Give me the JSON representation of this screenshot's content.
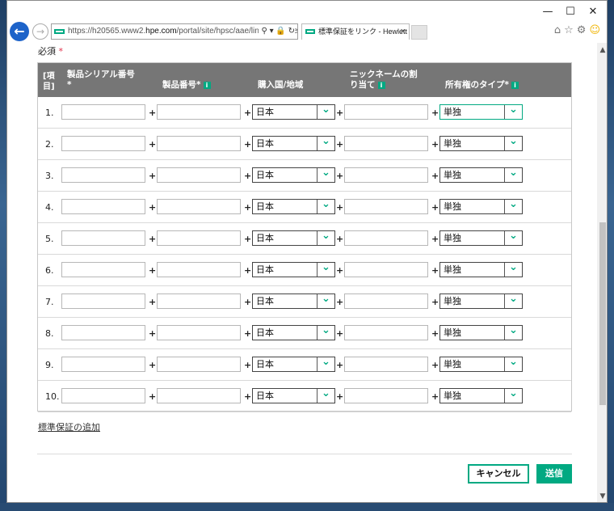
{
  "browser": {
    "url_prefix": "https://h20565.www2.",
    "url_domain": "hpe.com",
    "url_suffix": "/portal/site/hpsc/aae/linkWarranties.",
    "address_icons": "⚲ ▾ 🔒 ↻",
    "tab_title": "標準保証をリンク - Hewlett P...",
    "tab_close": "×",
    "minimize": "—",
    "maximize": "☐",
    "close": "✕",
    "back_glyph": "←",
    "forward_glyph": "→",
    "home_icon": "⌂",
    "star_icon": "☆",
    "gear_icon": "⚙",
    "smiley_icon": "☺"
  },
  "form": {
    "required_label": "必須",
    "required_star": "*",
    "headers": {
      "item": "[項\n目]",
      "serial": "製品シリアル番号",
      "serial_star": "*",
      "product": "製品番号",
      "product_star": "*",
      "country": "購入国/地域",
      "nickname": "ニックネームの割\nり当て",
      "ownership": "所有権のタイプ",
      "ownership_star": "*",
      "info": "i"
    },
    "plus": "+",
    "rows": [
      {
        "num": "1.",
        "country": "日本",
        "ownership": "単独"
      },
      {
        "num": "2.",
        "country": "日本",
        "ownership": "単独"
      },
      {
        "num": "3.",
        "country": "日本",
        "ownership": "単独"
      },
      {
        "num": "4.",
        "country": "日本",
        "ownership": "単独"
      },
      {
        "num": "5.",
        "country": "日本",
        "ownership": "単独"
      },
      {
        "num": "6.",
        "country": "日本",
        "ownership": "単独"
      },
      {
        "num": "7.",
        "country": "日本",
        "ownership": "単独"
      },
      {
        "num": "8.",
        "country": "日本",
        "ownership": "単独"
      },
      {
        "num": "9.",
        "country": "日本",
        "ownership": "単独"
      },
      {
        "num": "10.",
        "country": "日本",
        "ownership": "単独"
      }
    ],
    "add_link": "標準保証の追加",
    "cancel": "キャンセル",
    "submit": "送信",
    "chevron": "❯"
  },
  "colors": {
    "accent": "#01a982",
    "header_bg": "#767676",
    "required_star": "#e0304a",
    "browser_back": "#1d63c9"
  }
}
